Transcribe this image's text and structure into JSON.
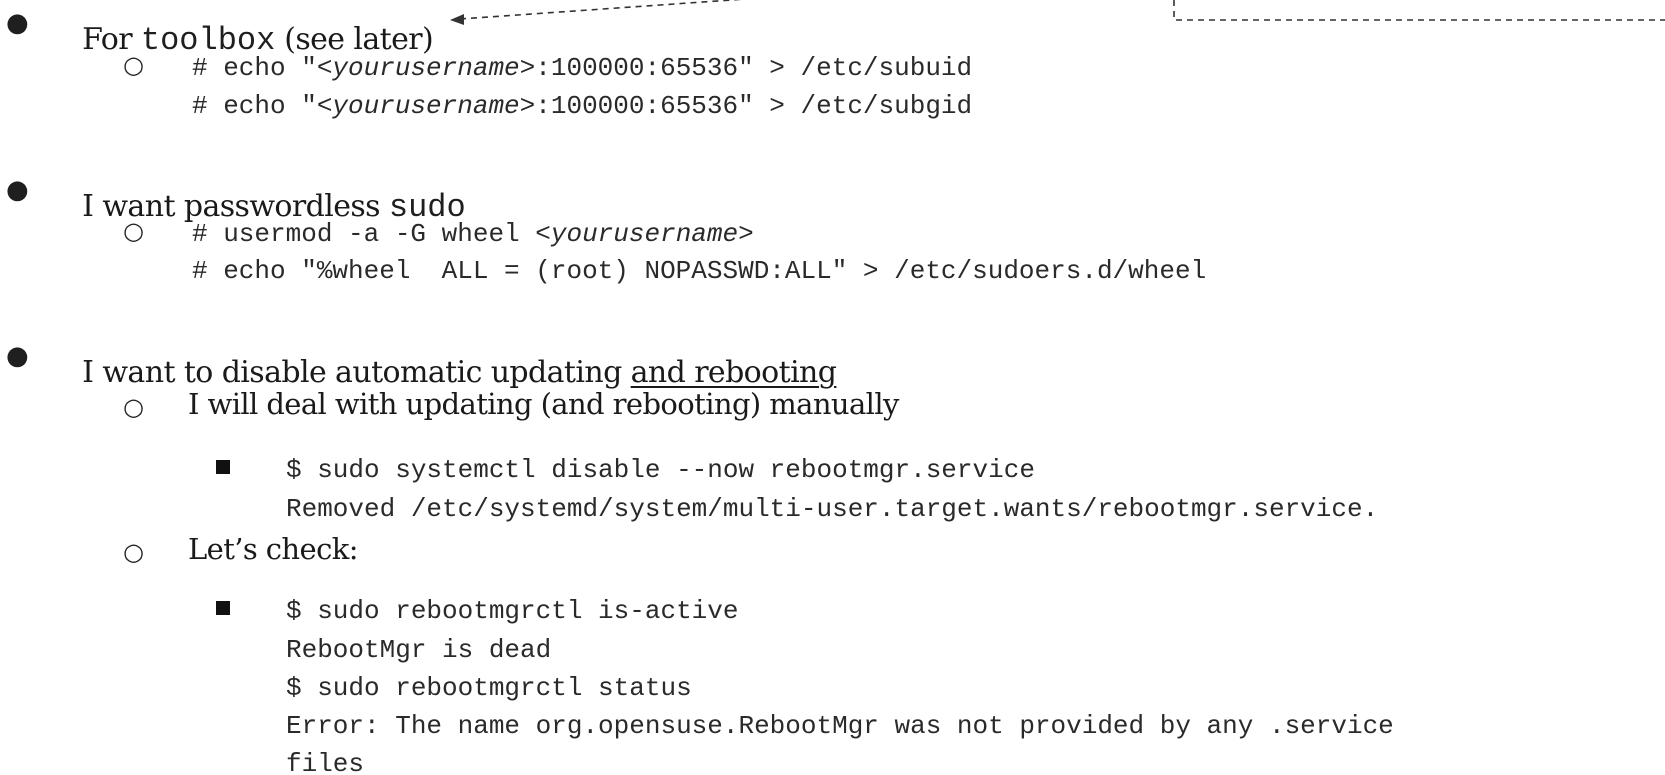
{
  "section_toolbox": {
    "heading": "For toolbox (see later)",
    "heading_prefix": "For ",
    "heading_word": "toolbox",
    "heading_suffix": " (see later)",
    "commands": [
      {
        "prefix": "# echo \"",
        "placeholder": "<yourusername>",
        "suffix": ":100000:65536\" > /etc/subuid"
      },
      {
        "prefix": "# echo \"",
        "placeholder": "<yourusername>",
        "suffix": ":100000:65536\" > /etc/subgid"
      }
    ]
  },
  "section_sudo": {
    "heading_prefix": "I want passwordless ",
    "heading_code": "sudo",
    "line1_prefix": "# usermod -a -G wheel ",
    "line1_placeholder": "<yourusername>",
    "line2": "# echo \"%wheel  ALL = (root) NOPASSWD:ALL\" > /etc/sudoers.d/wheel"
  },
  "section_updates": {
    "heading_prefix": "I want to disable automatic updating ",
    "heading_underlined": "and rebooting",
    "sub1": {
      "text": "I will deal with updating (and rebooting) manually",
      "lines": [
        "$ sudo systemctl disable --now rebootmgr.service",
        "Removed /etc/systemd/system/multi-user.target.wants/rebootmgr.service."
      ]
    },
    "sub2": {
      "text": "Let’s check:",
      "lines": [
        "$ sudo rebootmgrctl is-active",
        "RebootMgr is dead",
        "$ sudo rebootmgrctl status",
        "Error: The name org.opensuse.RebootMgr was not provided by any .service",
        "files"
      ]
    }
  },
  "glyphs": {
    "disc": "●",
    "circle": "○",
    "arrowhead": "◂"
  },
  "colors": {
    "text": "#1f1f1f",
    "annotation_line": "#333333"
  }
}
